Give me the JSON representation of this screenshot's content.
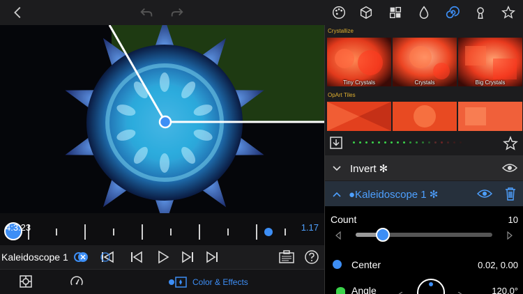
{
  "toolbar": {
    "left_icons": [
      "back-icon",
      "undo-icon",
      "redo-icon"
    ],
    "right_icons": [
      "palette-icon",
      "cube-icon",
      "grid-icon",
      "droplet-icon",
      "spiral-icon",
      "keyhole-icon",
      "star-icon"
    ],
    "active_icon": "spiral-icon",
    "accent": "#3d8ef5"
  },
  "timeline": {
    "time_left": "4:3.23",
    "time_right": "1.17"
  },
  "transport": {
    "layer_name": "Kaleidoscope 1",
    "buttons": [
      "skip-start",
      "step-back",
      "play",
      "step-forward",
      "skip-end"
    ]
  },
  "bottom": {
    "color_effects_label": "Color & Effects"
  },
  "panel": {
    "sections": [
      {
        "title": "Crystallize",
        "thumbs": [
          "Tiny Crystals",
          "Crystals",
          "Big Crystals"
        ]
      },
      {
        "title": "OpArt Tiles",
        "thumbs": [
          "",
          "",
          ""
        ]
      }
    ],
    "effects": [
      {
        "name": "Invert ✻",
        "expanded": false
      },
      {
        "name": "●Kaleidoscope 1 ✻",
        "expanded": true
      }
    ],
    "params": {
      "count_label": "Count",
      "count_value": "10",
      "count_fraction": 0.2,
      "center_label": "Center",
      "center_value": "0.02, 0.00",
      "angle_label": "Angle",
      "angle_value": "120.0°"
    }
  }
}
